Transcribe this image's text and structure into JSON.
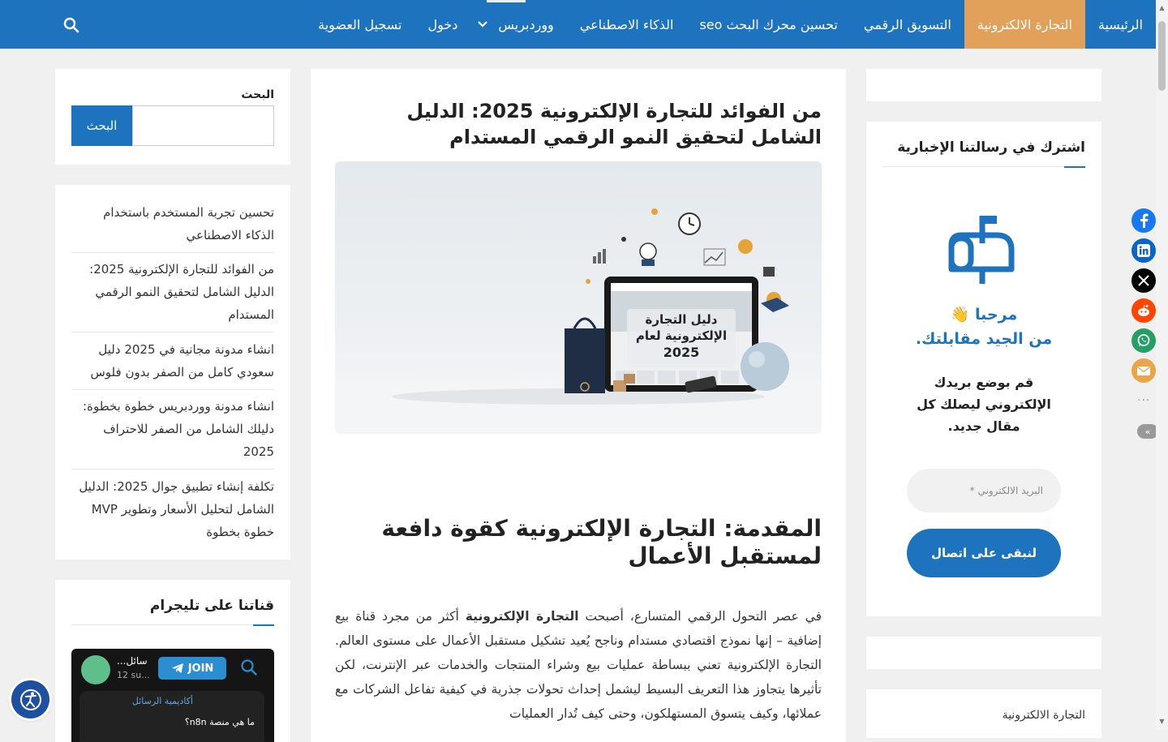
{
  "nav": {
    "items": [
      {
        "label": "الرئيسية",
        "active": false
      },
      {
        "label": "التجارة الالكترونية",
        "active": true
      },
      {
        "label": "التسويق الرقمي",
        "active": false
      },
      {
        "label": "تحسين محرك البحث seo",
        "active": false
      },
      {
        "label": "الذكاء الاصطناعي",
        "active": false
      },
      {
        "label": "ووردبريس",
        "active": false
      },
      {
        "label": "دخول",
        "active": false
      },
      {
        "label": "تسجيل العضوية",
        "active": false
      }
    ],
    "search_icon": "search-icon",
    "colors": {
      "bar": "#1e73be",
      "active": "#e2a15a"
    }
  },
  "search_widget": {
    "title": "البحث",
    "button_label": "البحث",
    "input_value": ""
  },
  "recent_posts": [
    "تحسين تجربة المستخدم باستخدام الذكاء الاصطناعي",
    "من الفوائد للتجارة الإلكترونية 2025: الدليل الشامل لتحقيق النمو الرقمي المستدام",
    "انشاء مدونة مجانية في 2025 دليل سعودي كامل من الصفر بدون فلوس",
    "انشاء مدونة ووردبريس خطوة بخطوة: دليلك الشامل من الصفر للاحتراف 2025",
    "تكلفة إنشاء تطبيق جوال 2025: الدليل الشامل لتحليل الأسعار وتطوير MVP خطوة بخطوة"
  ],
  "telegram_widget": {
    "title": "قناتنا على تليجرام",
    "channel_name": "...سائل",
    "subscribers": "12 su...",
    "join_label": "JOIN",
    "message_author": "أكاديمية الرسائل",
    "message_text": "ما هي منصة n8n؟"
  },
  "article": {
    "title": "من الفوائد للتجارة الإلكترونية 2025: الدليل الشامل لتحقيق النمو الرقمي المستدام",
    "image_text": {
      "line1": "دليل التجارة",
      "line2": "الإلكترونية لعام",
      "line3": "2025"
    },
    "section_heading": "المقدمة: التجارة الإلكترونية كقوة دافعة لمستقبل الأعمال",
    "paragraph": {
      "p1": "في عصر التحول الرقمي المتسارع، أصبحت ",
      "bold": "التجارة الإلكترونية",
      "p2": " أكثر من مجرد قناة بيع إضافية – إنها نموذج اقتصادي مستدام وناجح يُعيد تشكيل مستقبل الأعمال على مستوى العالم. التجارة الإلكترونية تعني ببساطة عمليات بيع وشراء المنتجات والخدمات عبر الإنترنت، لكن تأثيرها يتجاوز هذا التعريف البسيط ليشمل إحداث تحولات جذرية في كيفية تفاعل الشركات مع عملائها، وكيف يتسوق المستهلكون، وحتى كيف تُدار العمليات"
    }
  },
  "newsletter": {
    "title": "اشترك في رسالتنا الإخبارية",
    "hello": "مرحبا 👋",
    "nice": "من الجيد مقابلتك.",
    "desc_line1": "قم بوضع بريدك",
    "desc_line2": "الإلكتروني ليصلك كل",
    "desc_line3": "مقال جديد.",
    "email_placeholder": "البريد الالكتروني *",
    "button_label": "لنبقى على اتصال",
    "icon": "mailbox-icon"
  },
  "categories_widget": {
    "first_item": "التجارة الالكترونية"
  },
  "share": [
    {
      "name": "facebook-share",
      "color": "#1877f2"
    },
    {
      "name": "linkedin-share",
      "color": "#0a66c2"
    },
    {
      "name": "x-share",
      "color": "#000000"
    },
    {
      "name": "reddit-share",
      "color": "#ff4500"
    },
    {
      "name": "whatsapp-share",
      "color": "#25a064"
    },
    {
      "name": "email-share",
      "color": "#e9a54a"
    }
  ],
  "share_more": "···",
  "share_collapse": "«"
}
